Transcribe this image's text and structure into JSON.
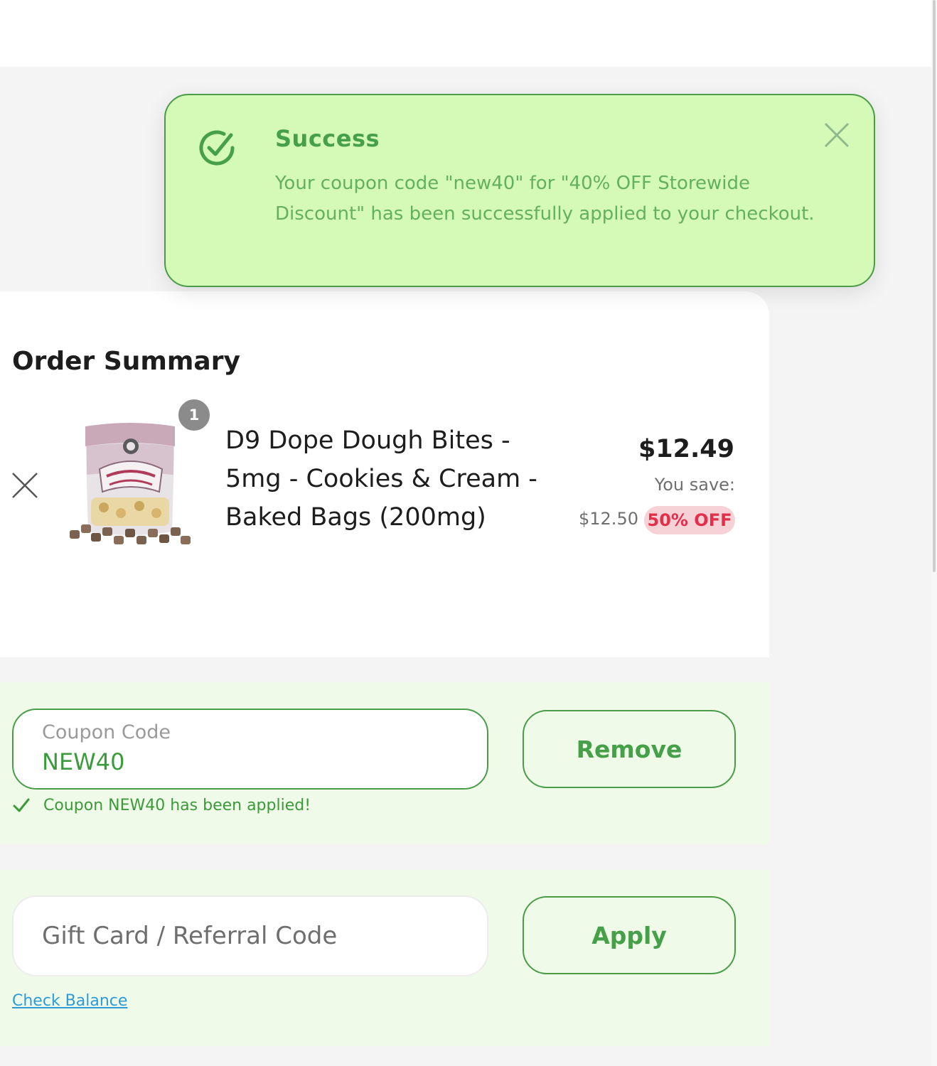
{
  "toast": {
    "title": "Success",
    "message": "Your coupon code \"new40\" for \"40% OFF Storewide Discount\" has been successfully applied to your checkout.",
    "color": "#d5f9b7",
    "border_color": "#4a9c48",
    "icon": "check-circle-icon",
    "close_icon": "close-icon"
  },
  "order_summary": {
    "title": "Order Summary",
    "items": [
      {
        "name": "D9 Dope Dough Bites - 5mg - Cookies & Cream - Baked Bags (200mg)",
        "quantity": "1",
        "price": "$12.49",
        "you_save_label": "You save:",
        "original_price": "$12.50",
        "discount_badge": "50% OFF",
        "remove_icon": "close-icon"
      }
    ]
  },
  "coupon": {
    "label": "Coupon Code",
    "value": "NEW40",
    "button_label": "Remove",
    "applied_message": "Coupon NEW40 has been applied!",
    "applied_icon": "check-icon"
  },
  "gift_card": {
    "placeholder": "Gift Card / Referral Code",
    "button_label": "Apply",
    "check_balance_link": "Check Balance"
  },
  "colors": {
    "accent_green": "#45a049",
    "discount_red": "#e3304a",
    "link_blue": "#2e9bd6",
    "section_bg": "#effbe8"
  }
}
